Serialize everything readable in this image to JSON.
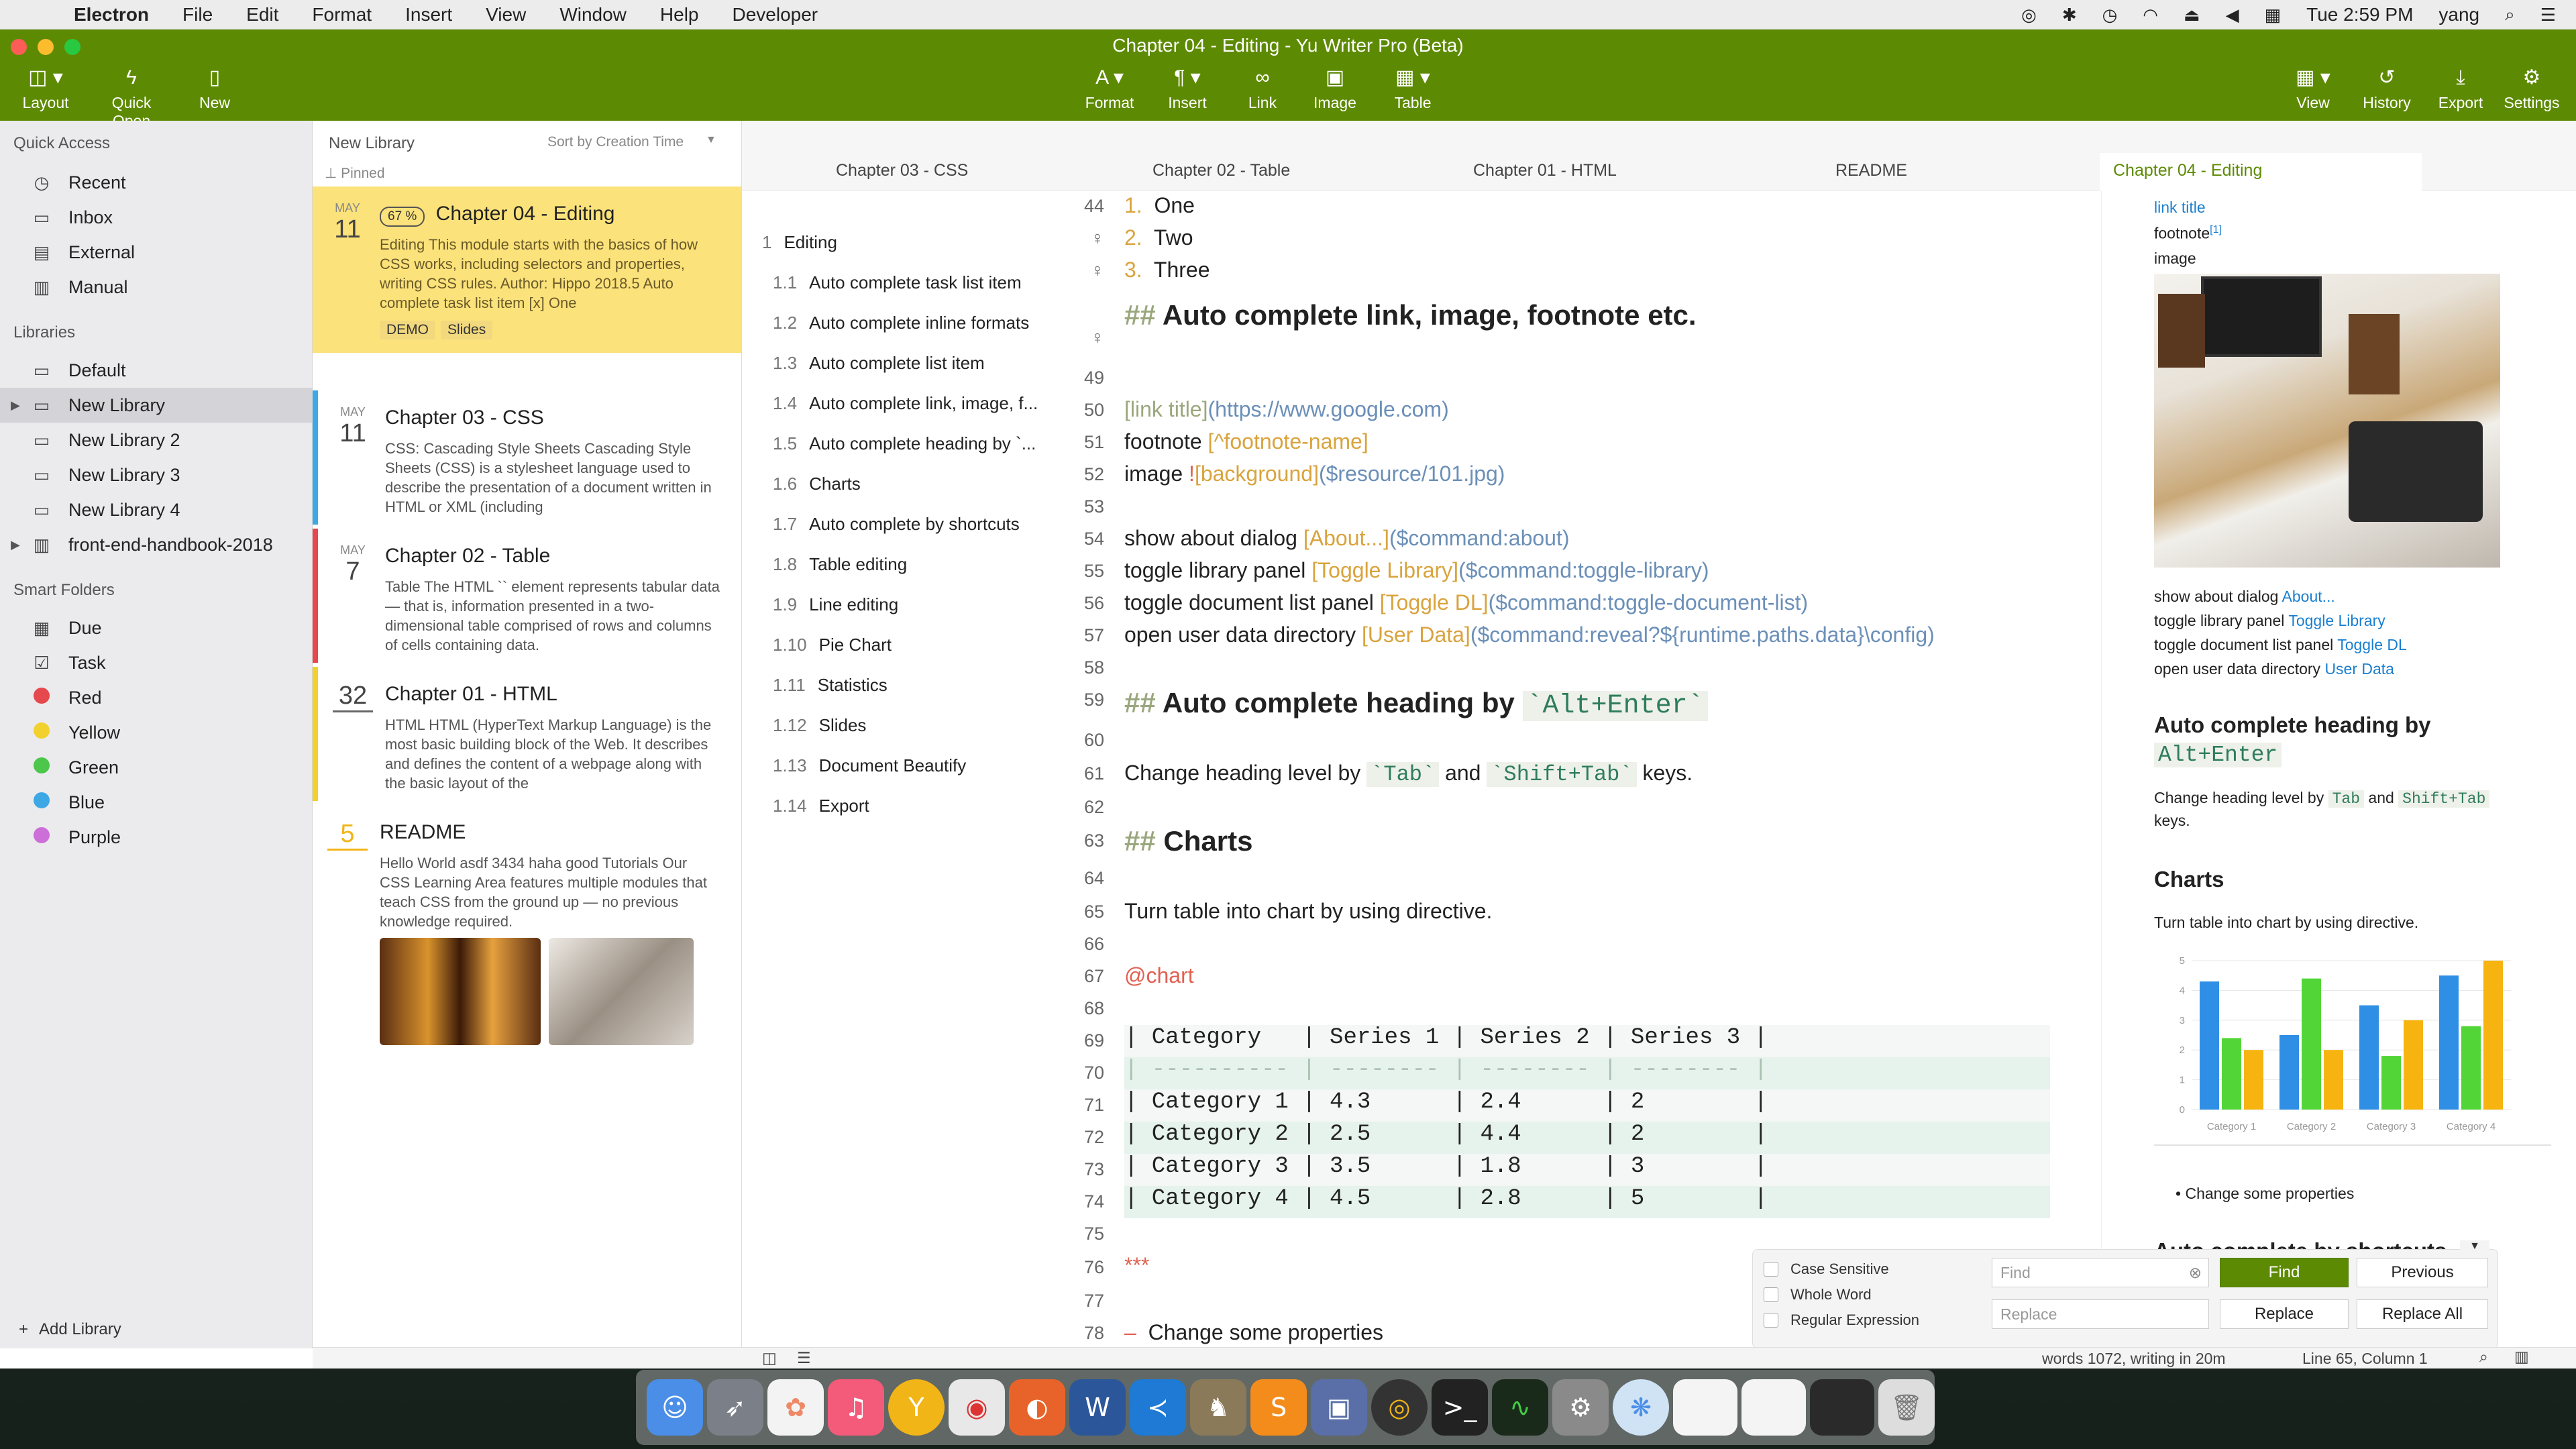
{
  "menubar": {
    "app_name": "Electron",
    "items": [
      "File",
      "Edit",
      "Format",
      "Insert",
      "View",
      "Window",
      "Help",
      "Developer"
    ],
    "clock": "Tue 2:59 PM",
    "user": "yang"
  },
  "window": {
    "title": "Chapter 04 - Editing - Yu Writer Pro (Beta)",
    "accent": "#5d8a03"
  },
  "toolbar": {
    "layout": "Layout",
    "quick_open": "Quick Open",
    "new": "New",
    "format": "Format",
    "insert": "Insert",
    "link": "Link",
    "image": "Image",
    "table": "Table",
    "view": "View",
    "history": "History",
    "export": "Export",
    "settings": "Settings"
  },
  "sidebar": {
    "quick_access_title": "Quick Access",
    "quick_access": [
      "Recent",
      "Inbox",
      "External",
      "Manual"
    ],
    "libraries_title": "Libraries",
    "libraries": [
      "Default",
      "New Library",
      "New Library 2",
      "New Library 3",
      "New Library 4",
      "front-end-handbook-2018"
    ],
    "smart_title": "Smart Folders",
    "smart": [
      "Due",
      "Task",
      "Red",
      "Yellow",
      "Green",
      "Blue",
      "Purple"
    ],
    "smart_colors": {
      "Red": "#e5484d",
      "Yellow": "#f2d12f",
      "Green": "#4cc64b",
      "Blue": "#3ea8e5",
      "Purple": "#cd6fd8"
    },
    "add_library": "Add Library"
  },
  "doclist": {
    "library": "New Library",
    "sort": "Sort by Creation Time",
    "pinned": "Pinned",
    "docs": [
      {
        "mon": "MAY",
        "day": "11",
        "badge": "67 %",
        "title": "Chapter 04 - Editing",
        "text": "Editing This module starts with the basics of how CSS works, including selectors and properties, writing CSS rules. Author: Hippo 2018.5 Auto complete task list item [x] One",
        "tags": [
          "DEMO",
          "Slides"
        ]
      },
      {
        "mon": "MAY",
        "day": "11",
        "title": "Chapter 03 - CSS",
        "text": "CSS: Cascading Style Sheets Cascading Style Sheets (CSS) is a stylesheet language used to describe the presentation of a document written in HTML or XML (including"
      },
      {
        "mon": "MAY",
        "day": "7",
        "title": "Chapter 02 - Table",
        "text": "Table The HTML `` element represents tabular data — that is, information presented in a two-dimensional table comprised of rows and columns of cells containing data."
      },
      {
        "mon": "",
        "day": "32",
        "title": "Chapter 01 - HTML",
        "text": "HTML HTML (HyperText Markup Language) is the most basic building block of the Web. It describes and defines the content of a webpage along with the basic layout of the"
      },
      {
        "mon": "",
        "day": "5",
        "title": "README",
        "text": "Hello World asdf 3434 haha good Tutorials Our CSS Learning Area features multiple modules that teach CSS from the ground up — no previous knowledge required."
      }
    ]
  },
  "tabs": [
    "Chapter 03 - CSS",
    "Chapter 02 - Table",
    "Chapter 01 - HTML",
    "README",
    "Chapter 04 - Editing"
  ],
  "outline": [
    {
      "n": "1",
      "t": "Editing"
    },
    {
      "n": "1.1",
      "t": "Auto complete task list item"
    },
    {
      "n": "1.2",
      "t": "Auto complete inline formats"
    },
    {
      "n": "1.3",
      "t": "Auto complete list item"
    },
    {
      "n": "1.4",
      "t": "Auto complete link, image, f..."
    },
    {
      "n": "1.5",
      "t": "Auto complete heading by `..."
    },
    {
      "n": "1.6",
      "t": "Charts"
    },
    {
      "n": "1.7",
      "t": "Auto complete by shortcuts"
    },
    {
      "n": "1.8",
      "t": "Table editing"
    },
    {
      "n": "1.9",
      "t": "Line editing"
    },
    {
      "n": "1.10",
      "t": "Pie Chart"
    },
    {
      "n": "1.11",
      "t": "Statistics"
    },
    {
      "n": "1.12",
      "t": "Slides"
    },
    {
      "n": "1.13",
      "t": "Document Beautify"
    },
    {
      "n": "1.14",
      "t": "Export"
    }
  ],
  "editor": {
    "lines": {
      "44": "One",
      "45": "Two",
      "46": "Three",
      "48": "Auto complete link, image, footnote etc.",
      "50a": "[link title]",
      "50b": "(https://www.google.com)",
      "51a": "footnote ",
      "51b": "[^footnote-name]",
      "52a": "image ",
      "52b": "!",
      "52c": "[background]",
      "52d": "($resource/101.jpg)",
      "54a": "show about dialog ",
      "54b": "[About...]",
      "54c": "($command:about)",
      "55a": "toggle library panel ",
      "55b": "[Toggle Library]",
      "55c": "($command:toggle-library)",
      "56a": "toggle document list panel ",
      "56b": "[Toggle DL]",
      "56c": "($command:toggle-document-list)",
      "57a": "open user data directory ",
      "57b": "[User Data]",
      "57c": "($command:reveal?${runtime.paths.data}\\config)",
      "59": "Auto complete heading by ",
      "59code": "`Alt+Enter`",
      "61a": "Change heading level by ",
      "61b": "`Tab`",
      "61c": " and ",
      "61d": "`Shift+Tab`",
      "61e": " keys.",
      "63": "Charts",
      "65": "Turn table into chart by using directive.",
      "67": "@chart",
      "69": "| Category   | Series 1 | Series 2 | Series 3 |",
      "70": "| ---------- | -------- | -------- | -------- |",
      "71": "| Category 1 | 4.3      | 2.4      | 2        |",
      "72": "| Category 2 | 2.5      | 4.4      | 2        |",
      "73": "| Category 3 | 3.5      | 1.8      | 3        |",
      "74": "| Category 4 | 4.5      | 2.8      | 5        |",
      "76": "***",
      "78": "Change some properties"
    }
  },
  "preview": {
    "link_title": "link title",
    "footnote": "footnote",
    "footnote_ref": "[1]",
    "image_label": "image",
    "about_label": "show about dialog ",
    "about_link": "About...",
    "lib_label": "toggle library panel ",
    "lib_link": "Toggle Library",
    "dl_label": "toggle document list panel ",
    "dl_link": "Toggle DL",
    "ud_label": "open user data directory ",
    "ud_link": "User Data",
    "h_heading": "Auto complete heading by",
    "h_code": "Alt+Enter",
    "change_a": "Change heading level by ",
    "change_tab": "Tab",
    "change_and": " and ",
    "change_shift": "Shift+Tab",
    "change_keys": "keys.",
    "h_charts": "Charts",
    "charts_text": "Turn table into chart by using directive.",
    "bullet": "Change some properties",
    "h_shortcuts": "Auto complete by shortcuts"
  },
  "chart_data": {
    "type": "bar",
    "categories": [
      "Category 1",
      "Category 2",
      "Category 3",
      "Category 4"
    ],
    "series": [
      {
        "name": "Series 1",
        "values": [
          4.3,
          2.5,
          3.5,
          4.5
        ],
        "color": "#2f8fe5"
      },
      {
        "name": "Series 2",
        "values": [
          2.4,
          4.4,
          1.8,
          2.8
        ],
        "color": "#52d637"
      },
      {
        "name": "Series 3",
        "values": [
          2,
          2,
          3,
          5
        ],
        "color": "#f7b410"
      }
    ],
    "yticks": [
      "0",
      "1",
      "2",
      "3",
      "4",
      "5"
    ],
    "ylim": [
      0,
      5
    ],
    "grid": true
  },
  "find": {
    "case": "Case Sensitive",
    "whole": "Whole Word",
    "regex": "Regular Expression",
    "find_ph": "Find",
    "replace_ph": "Replace",
    "find_btn": "Find",
    "prev_btn": "Previous",
    "replace_btn": "Replace",
    "replace_all_btn": "Replace All"
  },
  "status": {
    "words": "words 1072, writing in 20m",
    "pos": "Line 65, Column 1"
  }
}
